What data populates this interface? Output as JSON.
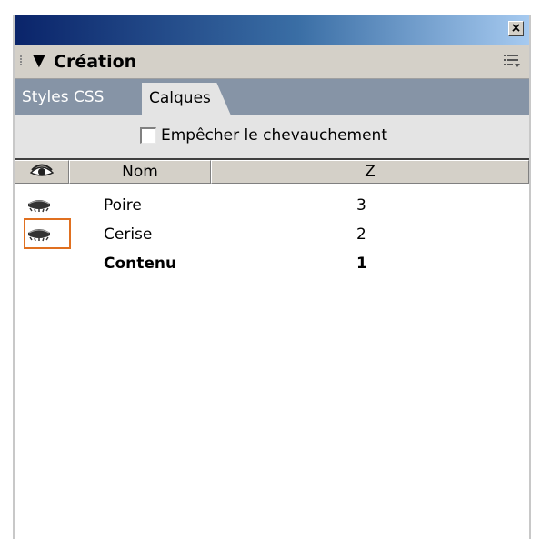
{
  "window": {
    "close_label": "×"
  },
  "panel": {
    "title": "Création",
    "collapse_glyph": "▼"
  },
  "tabs": [
    {
      "label": "Styles CSS",
      "active": false
    },
    {
      "label": "Calques",
      "active": true
    }
  ],
  "options": {
    "prevent_overlap_label": "Empêcher le chevauchement",
    "prevent_overlap_checked": false
  },
  "table": {
    "headers": {
      "visibility": "eye-icon",
      "name": "Nom",
      "z": "Z"
    },
    "rows": [
      {
        "name": "Poire",
        "z": "3",
        "visibility": "eye-closed-icon",
        "bold": false
      },
      {
        "name": "Cerise",
        "z": "2",
        "visibility": "eye-closed-icon",
        "bold": false,
        "focused": true
      },
      {
        "name": "Contenu",
        "z": "1",
        "visibility": "",
        "bold": true
      }
    ]
  },
  "colors": {
    "focus": "#e07020",
    "titlebar_start": "#0a246a",
    "tabbar": "#8694a6"
  }
}
